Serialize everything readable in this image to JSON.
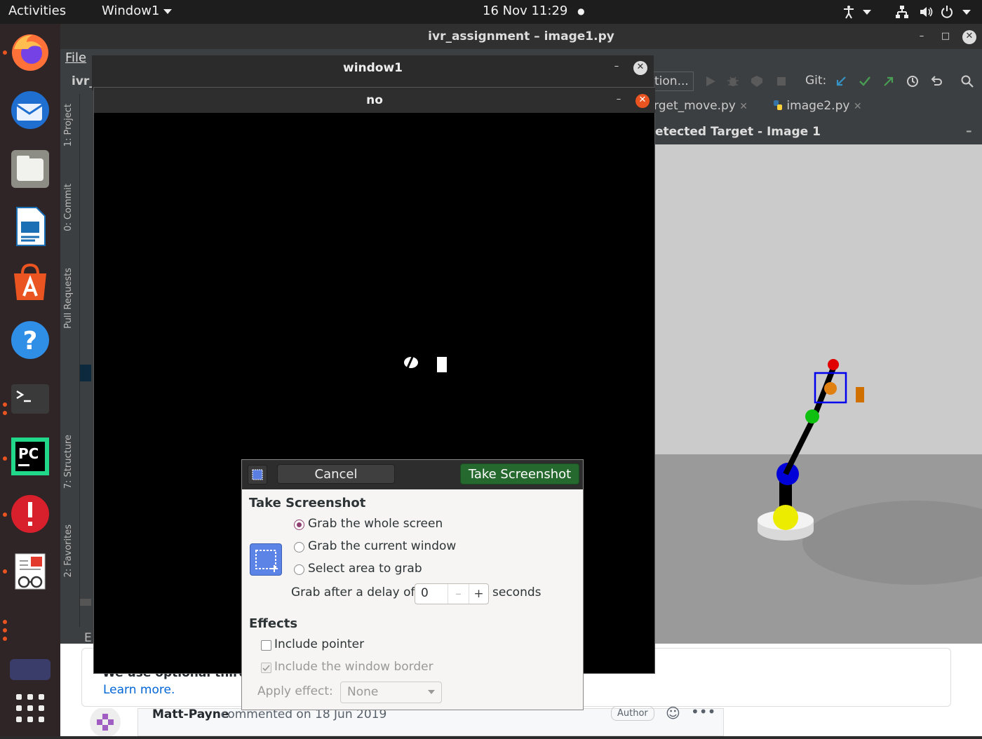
{
  "topbar": {
    "activities": "Activities",
    "app_menu": "Window1",
    "clock": "16 Nov  11:29"
  },
  "pycharm": {
    "title": "ivr_assignment – image1.py",
    "menu_file": "File",
    "project_short": "ivr_",
    "run_config": "tion...",
    "git_label": "Git:",
    "tool_windows": [
      "1: Project",
      "0: Commit",
      "Pull Requests",
      "7: Structure",
      "2: Favorites"
    ],
    "editor_tabs": [
      "rget_move.py",
      "image2.py"
    ],
    "panel_title": "etected Target - Image 1",
    "bottom_label": "E"
  },
  "window1": {
    "title": "window1"
  },
  "no_window": {
    "title": "no"
  },
  "dialog": {
    "cancel": "Cancel",
    "take": "Take Screenshot",
    "section_title": "Take Screenshot",
    "options": [
      "Grab the whole screen",
      "Grab the current window",
      "Select area to grab"
    ],
    "selected_option": 0,
    "delay_label": "Grab after a delay of",
    "delay_value": "0",
    "delay_unit": "seconds",
    "effects_title": "Effects",
    "include_pointer": "Include pointer",
    "include_pointer_checked": false,
    "include_border": "Include the window border",
    "include_border_checked": true,
    "apply_effect_label": "Apply effect:",
    "apply_effect_value": "None"
  },
  "webpage": {
    "cookie_text": "We use optional third pa",
    "learn_more": "Learn more.",
    "comment_author": "Matt-Payne",
    "comment_meta": "commented on 18 Jun 2019",
    "author_badge": "Author"
  },
  "colors": {
    "ubuntu_orange": "#e95420",
    "take_button": "#26692e",
    "radio_selected": "#8f3f71"
  }
}
